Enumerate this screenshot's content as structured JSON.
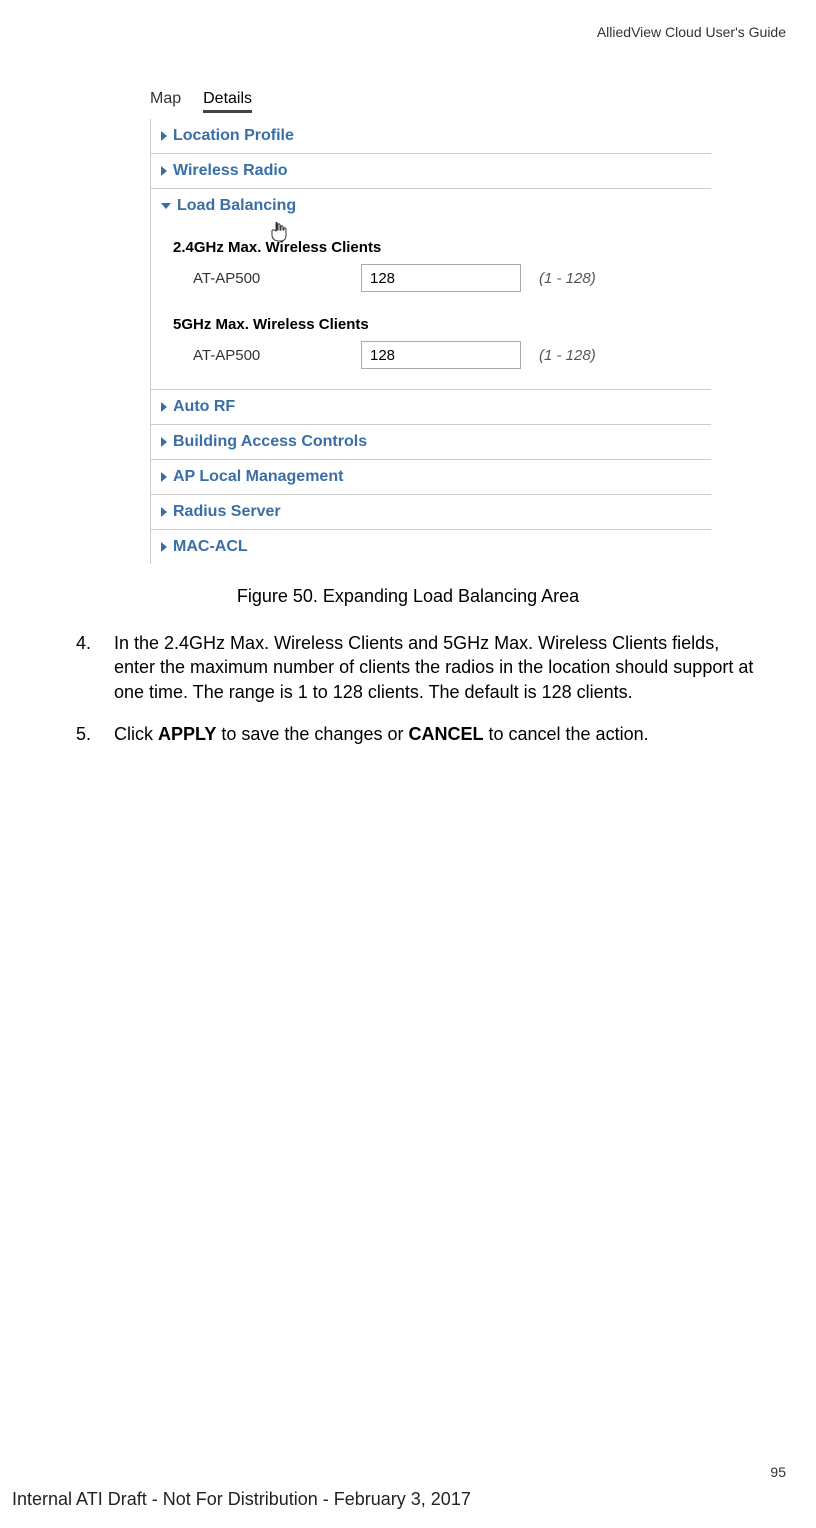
{
  "header": {
    "guide_title": "AlliedView Cloud User's Guide"
  },
  "screenshot": {
    "tabs": [
      "Map",
      "Details"
    ],
    "active_tab": "Details",
    "sections": {
      "location_profile": "Location Profile",
      "wireless_radio": "Wireless Radio",
      "load_balancing": "Load Balancing",
      "auto_rf": "Auto RF",
      "building_access": "Building Access Controls",
      "ap_local_mgmt": "AP Local Management",
      "radius_server": "Radius Server",
      "mac_acl": "MAC-ACL"
    },
    "load_balancing_content": {
      "group_24": {
        "heading": "2.4GHz Max. Wireless Clients",
        "label": "AT-AP500",
        "value": "128",
        "range": "(1 - 128)"
      },
      "group_5": {
        "heading": "5GHz Max. Wireless Clients",
        "label": "AT-AP500",
        "value": "128",
        "range": "(1 - 128)"
      }
    }
  },
  "figure_caption": "Figure 50. Expanding Load Balancing Area",
  "steps": {
    "s4_num": "4.",
    "s4_text": "In the 2.4GHz Max. Wireless Clients and 5GHz Max. Wireless Clients fields, enter the maximum number of clients the radios in the location should support at one time. The range is 1 to 128 clients. The default is 128 clients.",
    "s5_num": "5.",
    "s5_pre": "Click ",
    "s5_apply": "APPLY",
    "s5_mid": " to save the changes or ",
    "s5_cancel": "CANCEL",
    "s5_post": " to cancel the action."
  },
  "page_number": "95",
  "footer": "Internal ATI Draft - Not For Distribution - February 3, 2017"
}
